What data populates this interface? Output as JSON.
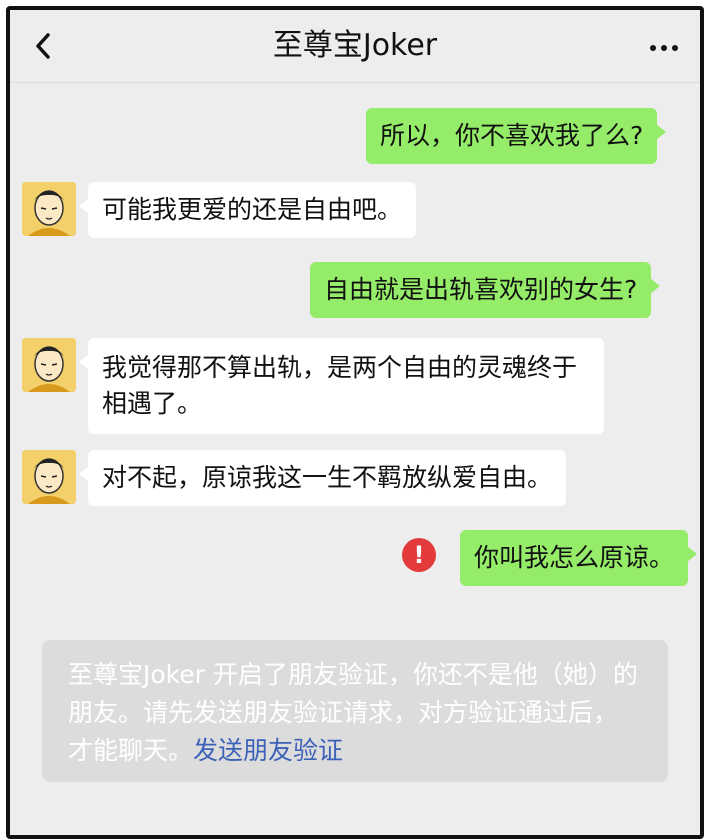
{
  "header": {
    "title": "至尊宝Joker",
    "back_icon": "chevron-left-icon",
    "more_icon": "more-dots-icon"
  },
  "messages": [
    {
      "sender": "me",
      "text": "所以，你不喜欢我了么?"
    },
    {
      "sender": "other",
      "text": "可能我更爱的还是自由吧。"
    },
    {
      "sender": "me",
      "text": "自由就是出轨喜欢别的女生?"
    },
    {
      "sender": "other",
      "text": "我觉得那不算出轨，是两个自由的灵魂终于相遇了。"
    },
    {
      "sender": "other",
      "text": "对不起，原谅我这一生不羁放纵爱自由。"
    },
    {
      "sender": "me",
      "text": "你叫我怎么原谅。",
      "failed": true
    }
  ],
  "error_icon": "!",
  "notice": {
    "text": "至尊宝Joker 开启了朋友验证，你还不是他（她）的朋友。请先发送朋友验证请求，对方验证通过后，才能聊天。",
    "link_text": "发送朋友验证"
  },
  "colors": {
    "my_bubble": "#95ec69",
    "other_bubble": "#ffffff",
    "background": "#ededed",
    "error": "#e33b3b",
    "link": "#3d61b8"
  }
}
